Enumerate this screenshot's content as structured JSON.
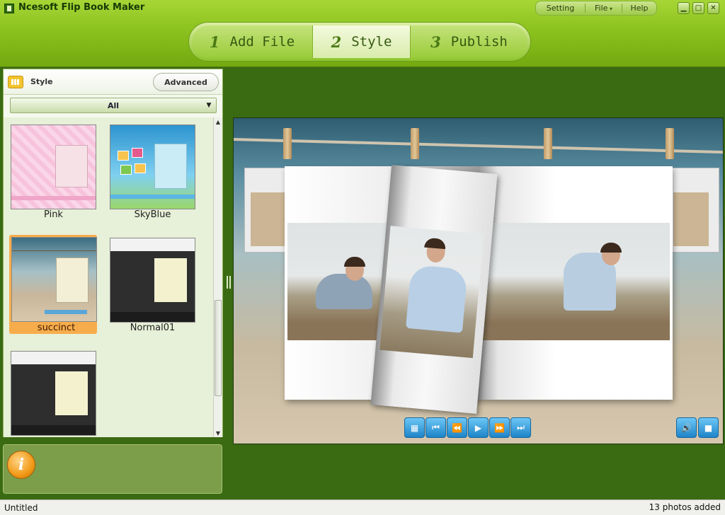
{
  "app": {
    "title": "Ncesoft Flip Book Maker"
  },
  "menu": {
    "setting": "Setting",
    "file": "File",
    "help": "Help"
  },
  "window_controls": {
    "minimize": "▁",
    "maximize": "□",
    "close": "✕"
  },
  "steps": [
    {
      "num": "1",
      "label": "Add File"
    },
    {
      "num": "2",
      "label": "Style",
      "active": true
    },
    {
      "num": "3",
      "label": "Publish"
    }
  ],
  "style_panel": {
    "title": "Style",
    "advanced_label": "Advanced",
    "filter": {
      "selected": "All",
      "arrow": "▼"
    },
    "thumbnails": [
      {
        "name": "Pink",
        "selected": false,
        "art": "pink"
      },
      {
        "name": "SkyBlue",
        "selected": false,
        "art": "sky"
      },
      {
        "name": "succinct",
        "selected": true,
        "art": "beach"
      },
      {
        "name": "Normal01",
        "selected": false,
        "art": "dark"
      },
      {
        "name": "",
        "selected": false,
        "art": "dark"
      }
    ],
    "scroll": {
      "up": "▲",
      "down": "▼"
    }
  },
  "info_panel": {
    "icon": "info-icon",
    "glyph": "i"
  },
  "preview": {
    "controls": [
      {
        "name": "thumbnails-button",
        "glyph": "▦"
      },
      {
        "name": "first-page-button",
        "glyph": "⏮"
      },
      {
        "name": "prev-page-button",
        "glyph": "⏪"
      },
      {
        "name": "play-button",
        "glyph": "▶"
      },
      {
        "name": "next-page-button",
        "glyph": "⏩"
      },
      {
        "name": "last-page-button",
        "glyph": "⏭"
      }
    ],
    "volume_glyph": "🔊",
    "fullscreen_glyph": "■"
  },
  "status": {
    "left": "Untitled",
    "right": "13 photos added"
  },
  "colors": {
    "header_green": "#8cc21e",
    "workspace_green": "#3a6a12",
    "selected_orange": "#f7ac4b",
    "control_blue": "#3aa0e0"
  }
}
